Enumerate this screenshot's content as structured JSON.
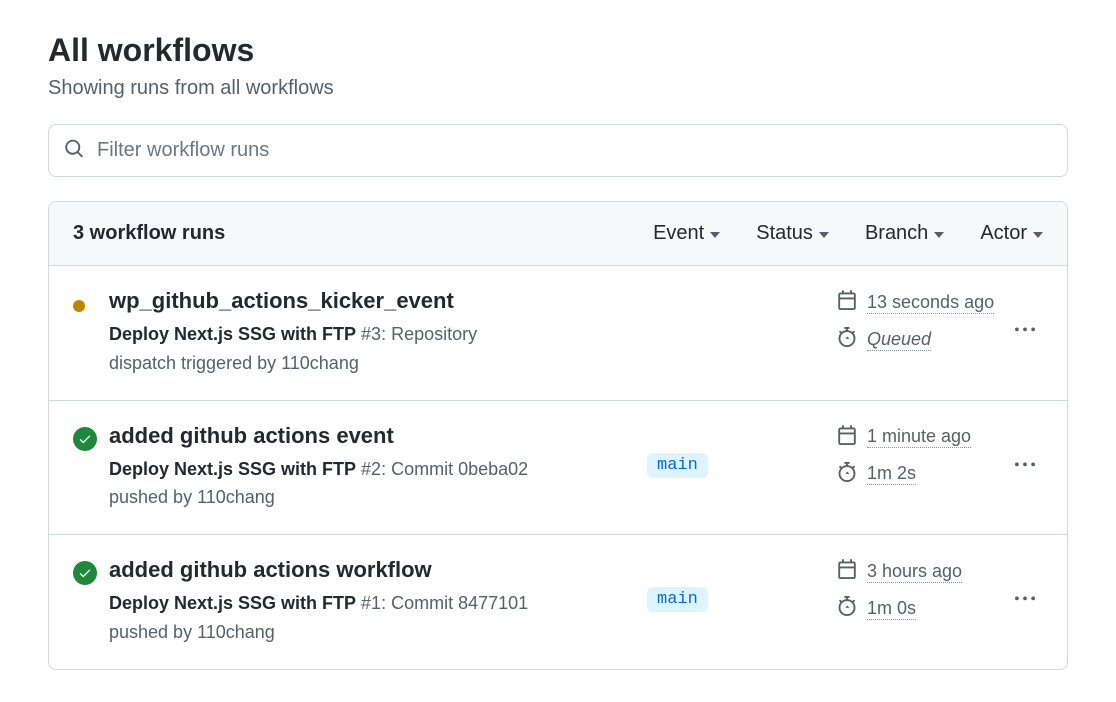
{
  "header": {
    "title": "All workflows",
    "subtitle": "Showing runs from all workflows"
  },
  "search": {
    "placeholder": "Filter workflow runs"
  },
  "panel": {
    "count_label": "3 workflow runs",
    "filters": {
      "event": "Event",
      "status": "Status",
      "branch": "Branch",
      "actor": "Actor"
    }
  },
  "runs": [
    {
      "status": "queued",
      "title": "wp_github_actions_kicker_event",
      "workflow": "Deploy Next.js SSG with FTP",
      "run_suffix": " #3: Repository dispatch triggered by 110chang",
      "branch": "",
      "time": "13 seconds ago",
      "duration": "Queued",
      "duration_italic": true
    },
    {
      "status": "success",
      "title": "added github actions event",
      "workflow": "Deploy Next.js SSG with FTP",
      "run_suffix": " #2: Commit 0beba02 pushed by 110chang",
      "branch": "main",
      "time": "1 minute ago",
      "duration": "1m 2s",
      "duration_italic": false
    },
    {
      "status": "success",
      "title": "added github actions workflow",
      "workflow": "Deploy Next.js SSG with FTP",
      "run_suffix": " #1: Commit 8477101 pushed by 110chang",
      "branch": "main",
      "time": "3 hours ago",
      "duration": "1m 0s",
      "duration_italic": false
    }
  ]
}
